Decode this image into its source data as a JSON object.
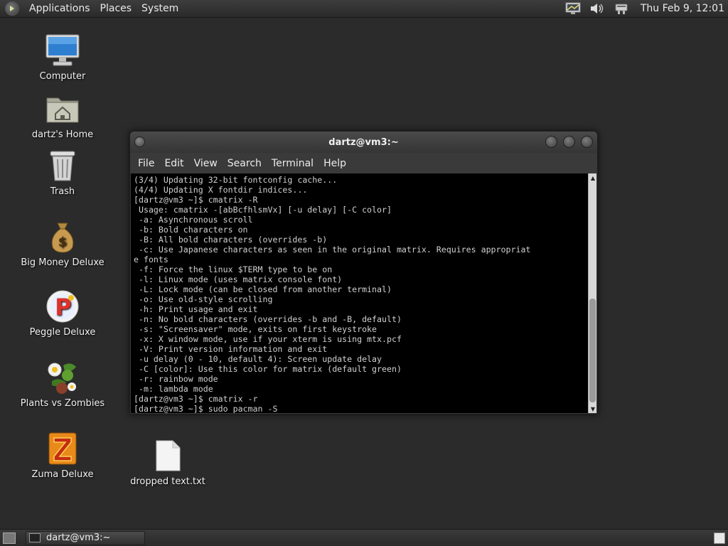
{
  "top_panel": {
    "menus": [
      "Applications",
      "Places",
      "System"
    ],
    "clock": "Thu Feb  9, 12:01",
    "tray_icons": [
      "display-icon",
      "volume-icon",
      "network-icon"
    ]
  },
  "desktop": {
    "icons": [
      {
        "label": "Computer",
        "icon": "computer-icon"
      },
      {
        "label": "dartz's Home",
        "icon": "home-folder-icon"
      },
      {
        "label": "Trash",
        "icon": "trash-icon"
      },
      {
        "label": "Big Money Deluxe",
        "icon": "money-bag-icon"
      },
      {
        "label": "Peggle Deluxe",
        "icon": "peggle-icon"
      },
      {
        "label": "Plants vs Zombies",
        "icon": "plants-icon"
      },
      {
        "label": "Zuma Deluxe",
        "icon": "zuma-icon"
      },
      {
        "label": "dropped text.txt",
        "icon": "text-file-icon"
      }
    ]
  },
  "terminal": {
    "title": "dartz@vm3:~",
    "menu": [
      "File",
      "Edit",
      "View",
      "Search",
      "Terminal",
      "Help"
    ],
    "lines": [
      "(3/4) Updating 32-bit fontconfig cache...",
      "(4/4) Updating X fontdir indices...",
      "[dartz@vm3 ~]$ cmatrix -R",
      " Usage: cmatrix -[abBcfhlsmVx] [-u delay] [-C color]",
      " -a: Asynchronous scroll",
      " -b: Bold characters on",
      " -B: All bold characters (overrides -b)",
      " -c: Use Japanese characters as seen in the original matrix. Requires appropriat",
      "e fonts",
      " -f: Force the linux $TERM type to be on",
      " -l: Linux mode (uses matrix console font)",
      " -L: Lock mode (can be closed from another terminal)",
      " -o: Use old-style scrolling",
      " -h: Print usage and exit",
      " -n: No bold characters (overrides -b and -B, default)",
      " -s: \"Screensaver\" mode, exits on first keystroke",
      " -x: X window mode, use if your xterm is using mtx.pcf",
      " -V: Print version information and exit",
      " -u delay (0 - 10, default 4): Screen update delay",
      " -C [color]: Use this color for matrix (default green)",
      " -r: rainbow mode",
      " -m: lambda mode",
      "[dartz@vm3 ~]$ cmatrix -r",
      "[dartz@vm3 ~]$ sudo pacman -S"
    ]
  },
  "taskbar": {
    "tasks": [
      {
        "label": "dartz@vm3:~"
      }
    ]
  }
}
